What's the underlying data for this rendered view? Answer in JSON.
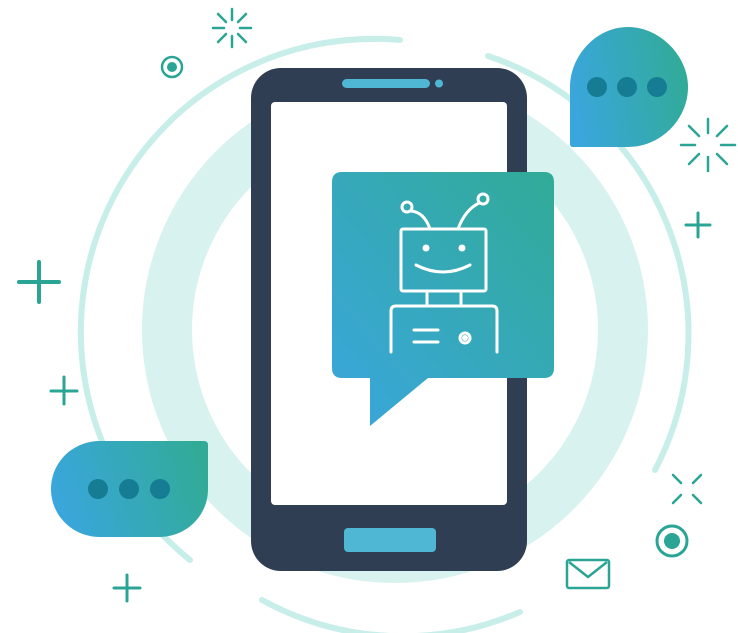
{
  "colors": {
    "background": "#ffffff",
    "phone_body": "#2f3e53",
    "phone_screen": "#ffffff",
    "phone_accent": "#4fb7d3",
    "ring_light": "#d7f2ef",
    "ring_outline": "#c8eeea",
    "gradient_blue": "#3aa6de",
    "gradient_teal": "#31ab97",
    "bubble_dots": "#167c93",
    "sparkle_teal": "#2aa595",
    "robot_line": "#ffffff"
  },
  "icons": {
    "phone": "smartphone-icon",
    "robot": "chatbot-robot-icon",
    "main_bubble": "speech-bubble-icon",
    "typing_bubble_top": "typing-dots-bubble-icon",
    "typing_bubble_bottom": "typing-dots-bubble-icon",
    "mail": "envelope-icon",
    "sparkles": [
      "sparkle-icon",
      "plus-icon",
      "target-dot-icon"
    ]
  }
}
